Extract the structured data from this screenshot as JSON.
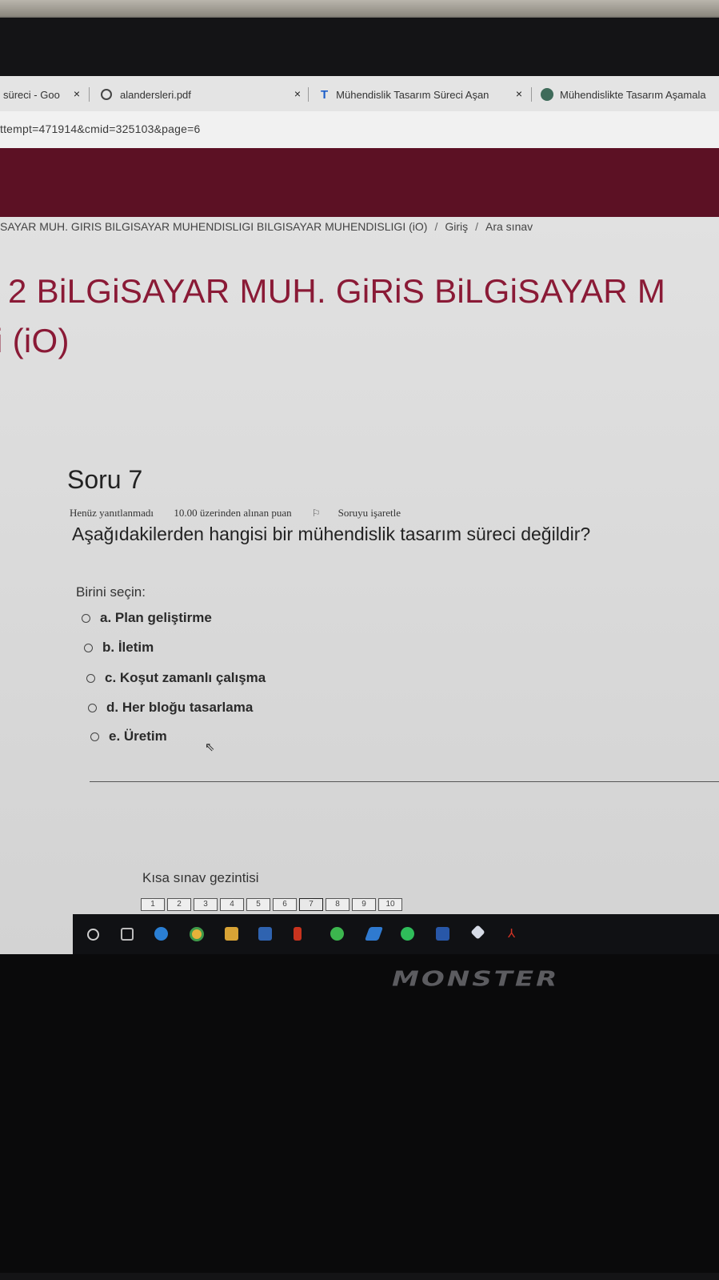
{
  "browser": {
    "tabs": [
      {
        "label": "süreci - Goo",
        "icon": "page-icon"
      },
      {
        "label": "alandersleri.pdf",
        "icon": "globe-icon"
      },
      {
        "label": "Mühendislik Tasarım Süreci Aşan",
        "icon": "t-logo-icon"
      },
      {
        "label": "Mühendislikte Tasarım Aşamala",
        "icon": "site-icon"
      }
    ],
    "close_glyph": "×",
    "url": "ttempt=471914&cmid=325103&page=6"
  },
  "breadcrumb": {
    "items": [
      "SAYAR MUH. GIRIS BILGISAYAR MUHENDISLIGI BILGISAYAR MUHENDISLIGI (iO)",
      "Giriş",
      "Ara sınav"
    ],
    "separator": "/"
  },
  "course": {
    "title_line1": "2 BiLGiSAYAR MUH. GiRiS BiLGiSAYAR M",
    "title_line2": "i (iO)",
    "title_color": "#8a1a36",
    "banner_color": "#5c1124"
  },
  "question": {
    "title": "Soru 7",
    "status": "Henüz yanıtlanmadı",
    "points": "10.00 üzerinden alınan puan",
    "flag_label": "Soruyu işaretle",
    "text": "Aşağıdakilerden hangisi bir mühendislik tasarım süreci değildir?",
    "prompt": "Birini seçin:",
    "options": [
      "a. Plan geliştirme",
      "b. İletim",
      "c. Koşut zamanlı çalışma",
      "d. Her bloğu tasarlama",
      "e. Üretim"
    ]
  },
  "quiz_nav": {
    "title": "Kısa sınav gezintisi",
    "pages": [
      "1",
      "2",
      "3",
      "4",
      "5",
      "6",
      "7",
      "8",
      "9",
      "10"
    ],
    "current": "7"
  },
  "taskbar": {
    "icons": [
      "search-icon",
      "task-view-icon",
      "edge-icon",
      "chrome-icon",
      "file-explorer-icon",
      "mail-icon",
      "office-icon",
      "whatsapp-icon",
      "todo-icon",
      "spotify-icon",
      "teams-icon",
      "3d-viewer-icon",
      "acrobat-icon"
    ]
  },
  "hardware": {
    "brand": "MONSTER"
  }
}
